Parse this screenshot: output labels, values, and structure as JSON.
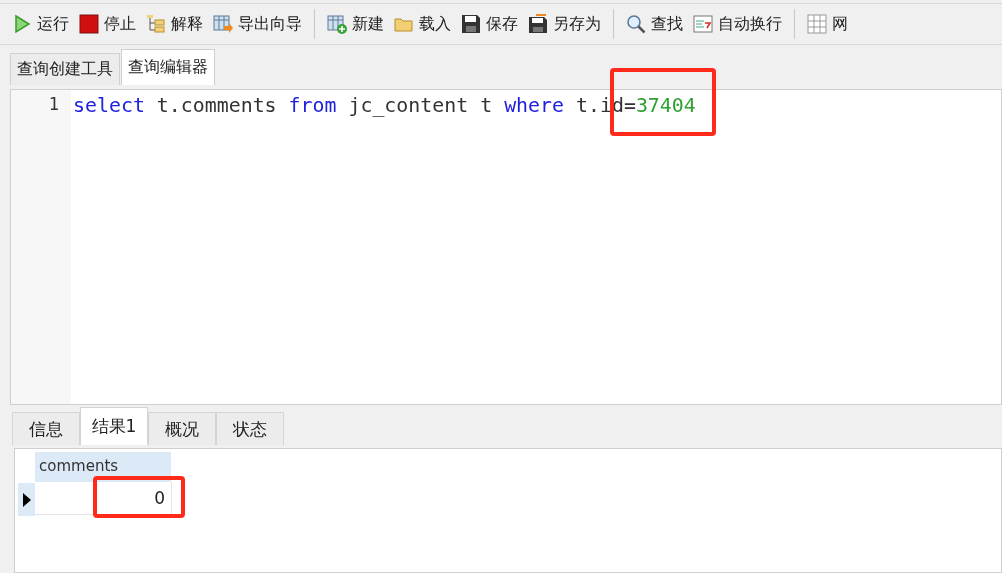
{
  "toolbar": {
    "groups": [
      [
        {
          "kind": "run",
          "label": "运行"
        },
        {
          "kind": "stop",
          "label": "停止"
        },
        {
          "kind": "explain",
          "label": "解释"
        },
        {
          "kind": "export",
          "label": "导出向导"
        }
      ],
      [
        {
          "kind": "new",
          "label": "新建"
        },
        {
          "kind": "load",
          "label": "载入"
        },
        {
          "kind": "save",
          "label": "保存"
        },
        {
          "kind": "saveas",
          "label": "另存为"
        }
      ],
      [
        {
          "kind": "find",
          "label": "查找"
        },
        {
          "kind": "wrap",
          "label": "自动换行"
        }
      ],
      [
        {
          "kind": "grid",
          "label": "网"
        }
      ]
    ]
  },
  "editor_tabs": [
    {
      "label": "查询创建工具",
      "selected": false
    },
    {
      "label": "查询编辑器",
      "selected": true
    }
  ],
  "editor": {
    "lines": [
      {
        "number": "1",
        "tokens": [
          {
            "kind": "keyword",
            "text": "select"
          },
          {
            "kind": "plain",
            "text": " t.comments "
          },
          {
            "kind": "keyword",
            "text": "from"
          },
          {
            "kind": "plain",
            "text": " jc_content t "
          },
          {
            "kind": "keyword",
            "text": "where"
          },
          {
            "kind": "plain",
            "text": " t.i"
          },
          {
            "kind": "group",
            "highlighted": true,
            "children": [
              {
                "kind": "plain",
                "text": "d="
              },
              {
                "kind": "number",
                "text": "37404"
              }
            ]
          }
        ]
      }
    ]
  },
  "result_tabs": [
    {
      "label": "信息",
      "selected": false
    },
    {
      "label": "结果1",
      "selected": true
    },
    {
      "label": "概况",
      "selected": false
    },
    {
      "label": "状态",
      "selected": false
    }
  ],
  "result_grid": {
    "columns": [
      "comments"
    ],
    "rows": [
      {
        "current": true,
        "cells": [
          {
            "text": "0",
            "highlighted": true
          }
        ]
      }
    ]
  }
}
